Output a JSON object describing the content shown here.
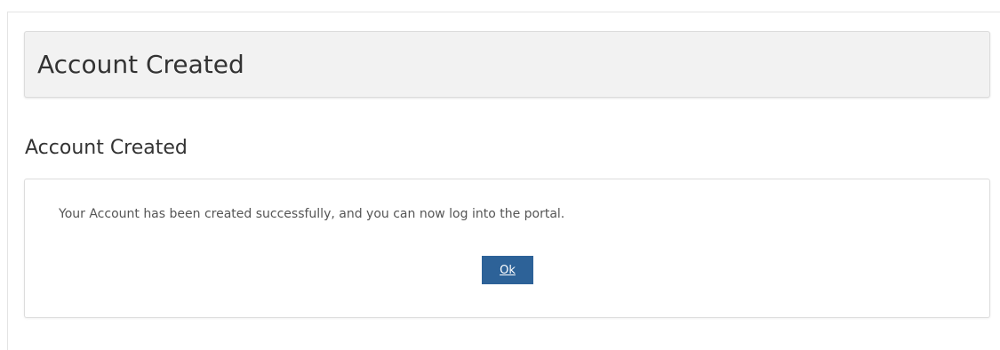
{
  "header": {
    "title": "Account Created"
  },
  "section": {
    "heading": "Account Created"
  },
  "panel": {
    "message": "Your Account has been created successfully, and you can now log into the portal.",
    "ok_label": "Ok"
  },
  "colors": {
    "button_background": "#2d6298",
    "header_background": "#f2f2f2",
    "text": "#333333"
  }
}
